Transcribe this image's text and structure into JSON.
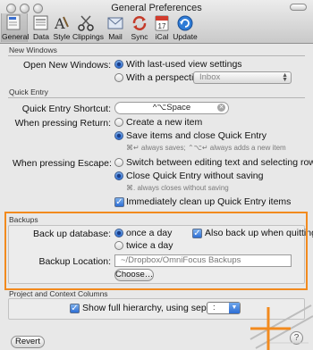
{
  "window": {
    "title": "General Preferences"
  },
  "toolbar": {
    "items": [
      {
        "label": "General",
        "icon": "general-icon"
      },
      {
        "label": "Data",
        "icon": "data-icon"
      },
      {
        "label": "Style",
        "icon": "style-icon"
      },
      {
        "label": "Clippings",
        "icon": "clippings-icon"
      },
      {
        "label": "Mail",
        "icon": "mail-icon"
      },
      {
        "label": "Sync",
        "icon": "sync-icon"
      },
      {
        "label": "iCal",
        "icon": "ical-icon"
      },
      {
        "label": "Update",
        "icon": "update-icon"
      }
    ],
    "selected": "General"
  },
  "new_windows": {
    "header": "New Windows",
    "open_label": "Open New Windows:",
    "option_saved": "With last-used view settings",
    "option_perspective": "With a perspective:",
    "perspective_value": "Inbox"
  },
  "quick_entry": {
    "header": "Quick Entry",
    "shortcut_label": "Quick Entry Shortcut:",
    "shortcut_value": "^⌥Space",
    "return_label": "When pressing Return:",
    "return_opt1": "Create a new item",
    "return_opt2": "Save items and close Quick Entry",
    "return_hint": "⌘↵ always saves; ⌃⌥↵ always adds a new item",
    "escape_label": "When pressing Escape:",
    "escape_opt1": "Switch between editing text and selecting row",
    "escape_opt2": "Close Quick Entry without saving",
    "escape_hint": "⌘. always closes without saving",
    "cleanup_label": "Immediately clean up Quick Entry items"
  },
  "backups": {
    "header": "Backups",
    "backup_label": "Back up database:",
    "opt_once": "once a day",
    "opt_twice": "twice a day",
    "quitting_label": "Also back up when quitting",
    "location_label": "Backup Location:",
    "location_value": "~/Dropbox/OmniFocus Backups",
    "choose_label": "Choose…"
  },
  "project_columns": {
    "header": "Project and Context Columns",
    "hierarchy_label": "Show full hierarchy, using separator:",
    "separator_value": ":"
  },
  "footer": {
    "revert_label": "Revert",
    "help_label": "?"
  },
  "colors": {
    "highlight": "#f28a1e",
    "accent": "#2d6ed5"
  }
}
